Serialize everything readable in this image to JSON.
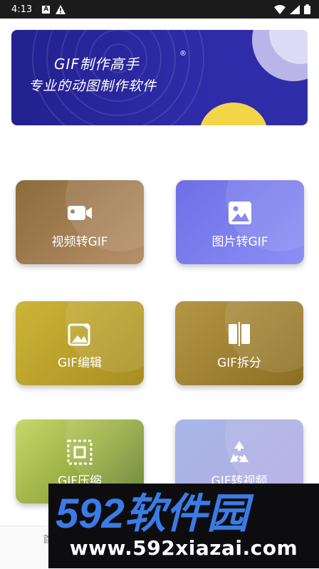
{
  "status_bar": {
    "time": "4:13",
    "icons": [
      "a-notification-icon",
      "warning-icon",
      "wifi-icon",
      "signal-icon",
      "battery-icon"
    ]
  },
  "banner": {
    "title": "GIF制作高手",
    "reg_mark": "®",
    "subtitle": "专业的动图制作软件",
    "colors": {
      "background": "#2a27a0",
      "accent_yellow": "#f3d54a"
    }
  },
  "features": [
    {
      "label": "视频转GIF",
      "icon": "video-camera-icon",
      "color_from": "#8c6b3c",
      "color_to": "#b8906a"
    },
    {
      "label": "图片转GIF",
      "icon": "image-icon",
      "color_from": "#6f6fe6",
      "color_to": "#8c8ff5"
    },
    {
      "label": "GIF编辑",
      "icon": "edit-image-icon",
      "color_from": "#cdb437",
      "color_to": "#a88e22"
    },
    {
      "label": "GIF拆分",
      "icon": "split-icon",
      "color_from": "#b59645",
      "color_to": "#8c6e23"
    },
    {
      "label": "GIF压缩",
      "icon": "compress-icon",
      "color_from": "#c8d86a",
      "color_to": "#5b7a2a"
    },
    {
      "label": "GIF转视频",
      "icon": "recycle-icon",
      "color_from": "#a8b8e8",
      "color_to": "#b2a8e2"
    }
  ],
  "bottom_nav": {
    "tab_label": "首"
  },
  "watermark": {
    "brand": "592软件园",
    "url": "www.592xiazai.com",
    "colors": {
      "digits": "#3b7be6",
      "text": "#ffffff"
    }
  }
}
